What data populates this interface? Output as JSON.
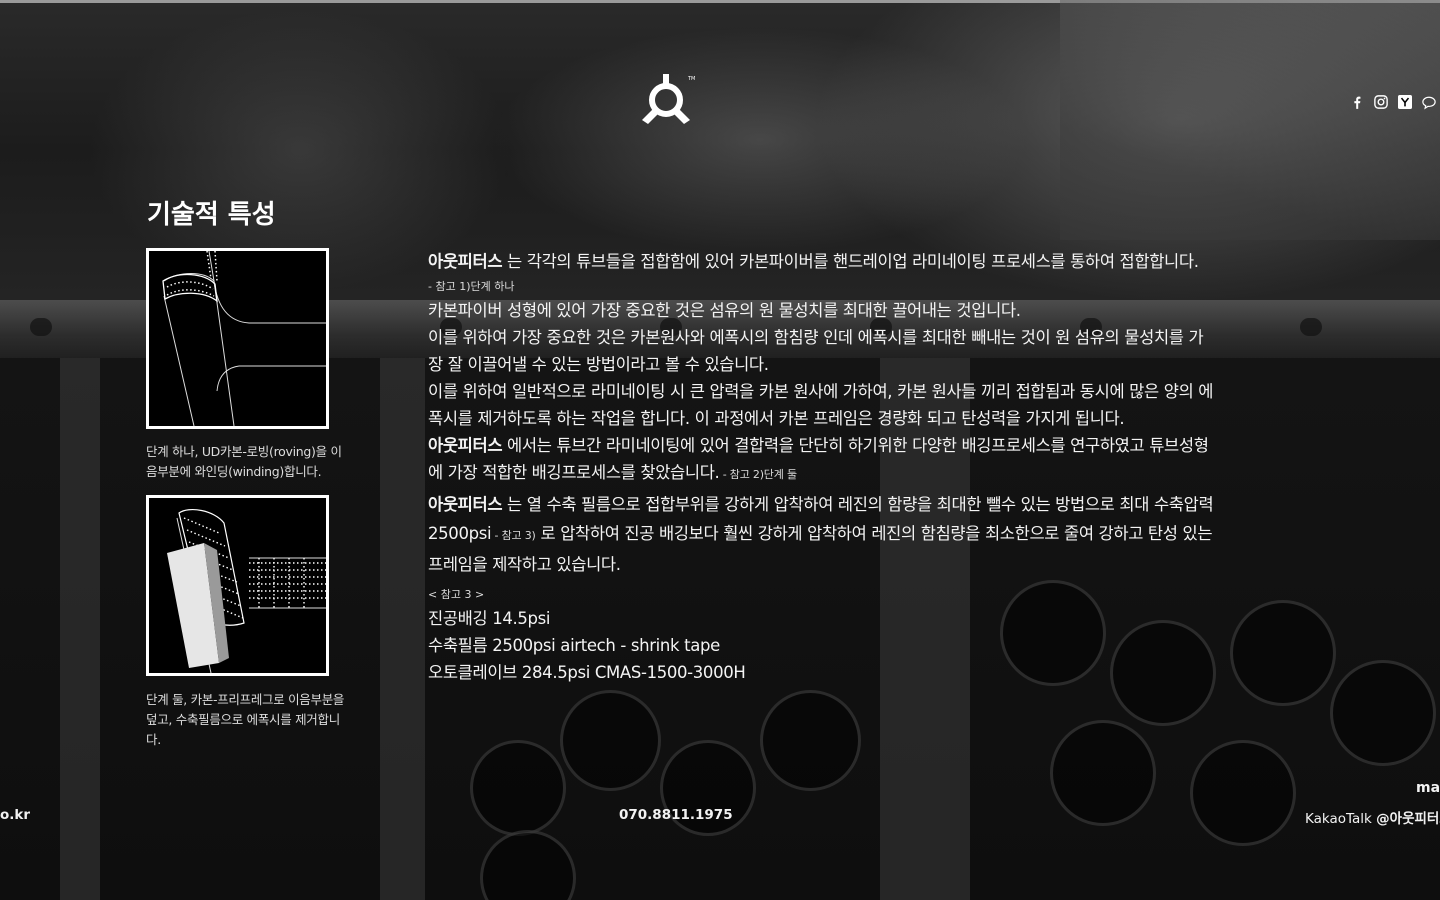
{
  "header": {
    "social_icons": [
      "facebook-icon",
      "instagram-icon",
      "y-icon",
      "chat-bubble-icon"
    ]
  },
  "section_title": "기술적 특성",
  "figures": [
    {
      "caption": "단계 하나, UD카본-로빙(roving)을 이음부분에 와인딩(winding)합니다."
    },
    {
      "caption": "단계 둘, 카본-프리프레그로 이음부분을 덮고, 수축필름으로 에폭시를 제거합니다."
    }
  ],
  "content": {
    "brand": "아웃피터스",
    "p1_rest": " 는 각각의 튜브들을 접합함에 있어 카본파이버를 핸드레이업 라미네이팅 프로세스를 통하여 접합합니다.",
    "ref1": "- 참고 1)단계 하나",
    "p2": "카본파이버 성형에 있어 가장 중요한 것은 섬유의 원 물성치를 최대한 끌어내는 것입니다.",
    "p3": "이를 위하여 가장 중요한 것은 카본원사와 에폭시의 함침량 인데 에폭시를 최대한 빼내는 것이 원 섬유의 물성치를 가장 잘 이끌어낼 수 있는 방법이라고 볼 수 있습니다.",
    "p4": "이를 위하여 일반적으로 라미네이팅 시 큰 압력을 카본 원사에 가하여, 카본 원사들 끼리 접합됨과 동시에 많은 양의 에폭시를 제거하도록 하는 작업을 합니다. 이 과정에서 카본 프레임은 경량화 되고 탄성력을 가지게 됩니다.",
    "p5_rest": " 에서는 튜브간 라미네이팅에 있어 결합력을 단단히 하기위한 다양한 배깅프로세스를 연구하였고 튜브성형에 가장 적합한 배깅프로세스를 찾았습니다.",
    "ref2": " - 참고 2)단계 둘",
    "p6_a": " 는 열 수축 필름으로 접합부위를 강하게 압착하여 레진의 함량을 최대한 뺄수 있는 방법으로 최대 수축압력 2500psi",
    "ref3": " - 참고 3)",
    "p6_b": " 로 압착하여 진공 배깅보다 훨씬 강하게 압착하여 레진의 함침량을 최소한으로 줄여 강하고 탄성 있는 프레임을 제작하고 있습니다.",
    "ref3_title": "< 참고 3 >",
    "specs": [
      "진공배깅 14.5psi",
      "수축필름 2500psi airtech - shrink tape",
      "오토클레이브 284.5psi CMAS-1500-3000H"
    ]
  },
  "footer": {
    "left_text": "o.kr",
    "phone": "070.8811.1975",
    "kakao_label": "KakaoTalk ",
    "kakao_handle": "@아웃피터스",
    "right_top": "ma"
  }
}
